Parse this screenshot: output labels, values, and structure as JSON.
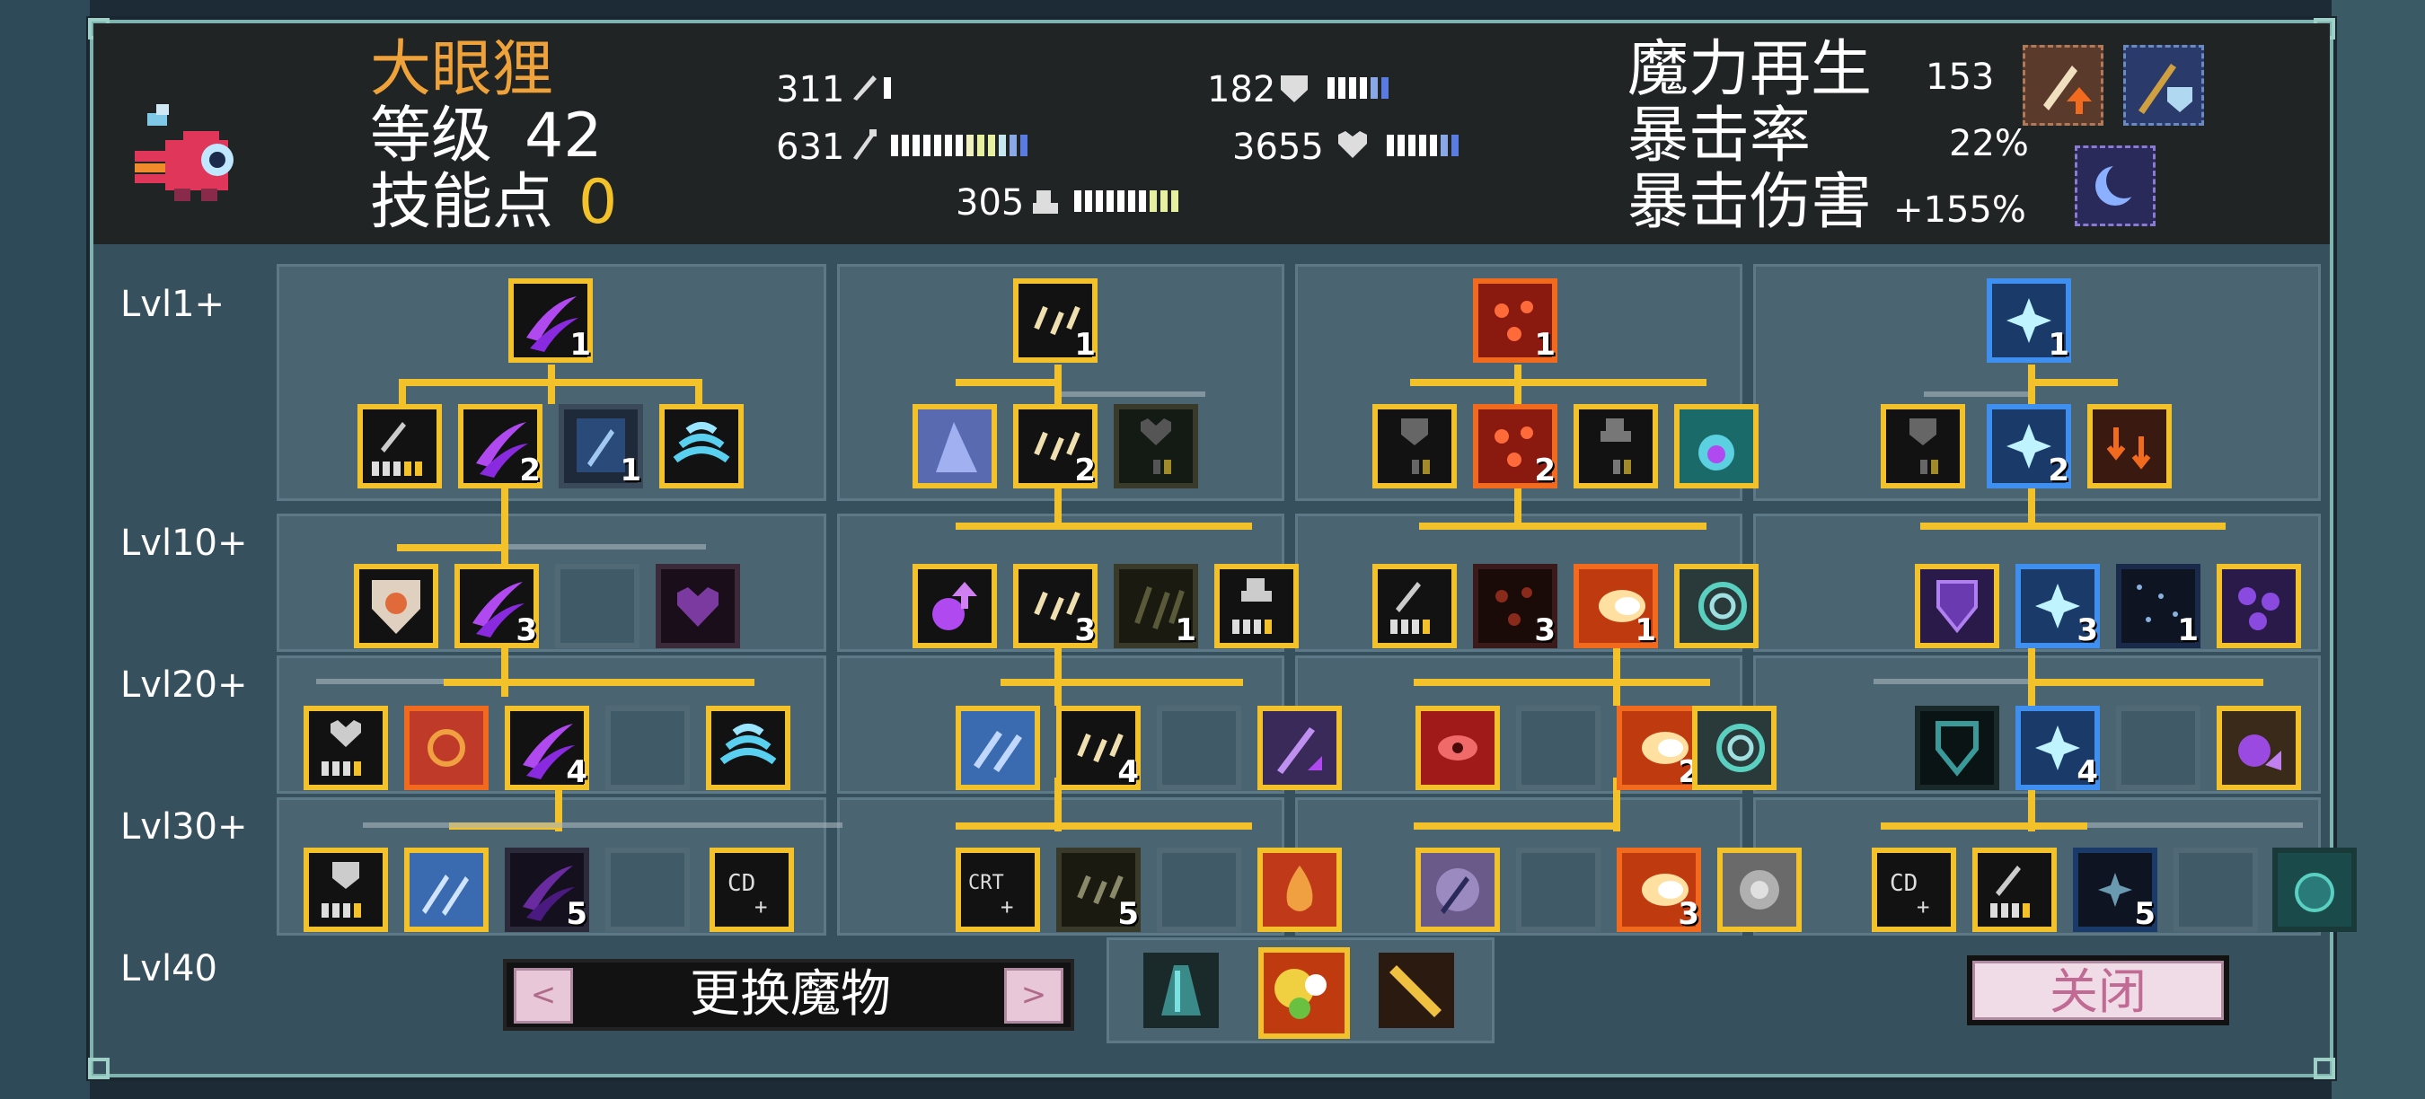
{
  "monster": {
    "name": "大眼狸",
    "level_label": "等级",
    "level": "42",
    "skill_points_label": "技能点",
    "skill_points": "0"
  },
  "stats": {
    "attack": "311",
    "magic_attack": "631",
    "defense": "182",
    "hp": "3655",
    "speed": "305"
  },
  "derived": {
    "mana_regen_label": "魔力再生",
    "mana_regen": "153",
    "crit_rate_label": "暴击率",
    "crit_rate": "22%",
    "crit_damage_label": "暴击伤害",
    "crit_damage": "+155%"
  },
  "levels": [
    "Lvl1+",
    "Lvl10+",
    "Lvl20+",
    "Lvl30+",
    "Lvl40"
  ],
  "skill_levels": {
    "t1_root": "1",
    "t1_r2": "2",
    "t1_blue": "1",
    "t1_r3": "3",
    "t1_r4": "4",
    "t1_r5": "5",
    "t2_root": "1",
    "t2_r2": "2",
    "t2_r3": "3",
    "t2_dark": "1",
    "t2_r4": "4",
    "t2_r5": "5",
    "t3_root": "1",
    "t3_r2": "2",
    "t3_dots": "3",
    "t3_fire": "1",
    "t3_fire2": "2",
    "t3_fire3": "3",
    "t4_root": "1",
    "t4_r2": "2",
    "t4_r3": "3",
    "t4_rain": "1",
    "t4_r4": "4",
    "t4_r5": "5"
  },
  "buttons": {
    "switch_monster": "更换魔物",
    "prev": "<",
    "next": ">",
    "close": "关闭"
  },
  "colors": {
    "gold": "#f3c12a",
    "orange_name": "#f0a23a",
    "purple": "#9a3ff0",
    "frame": "#7fb3b0"
  }
}
